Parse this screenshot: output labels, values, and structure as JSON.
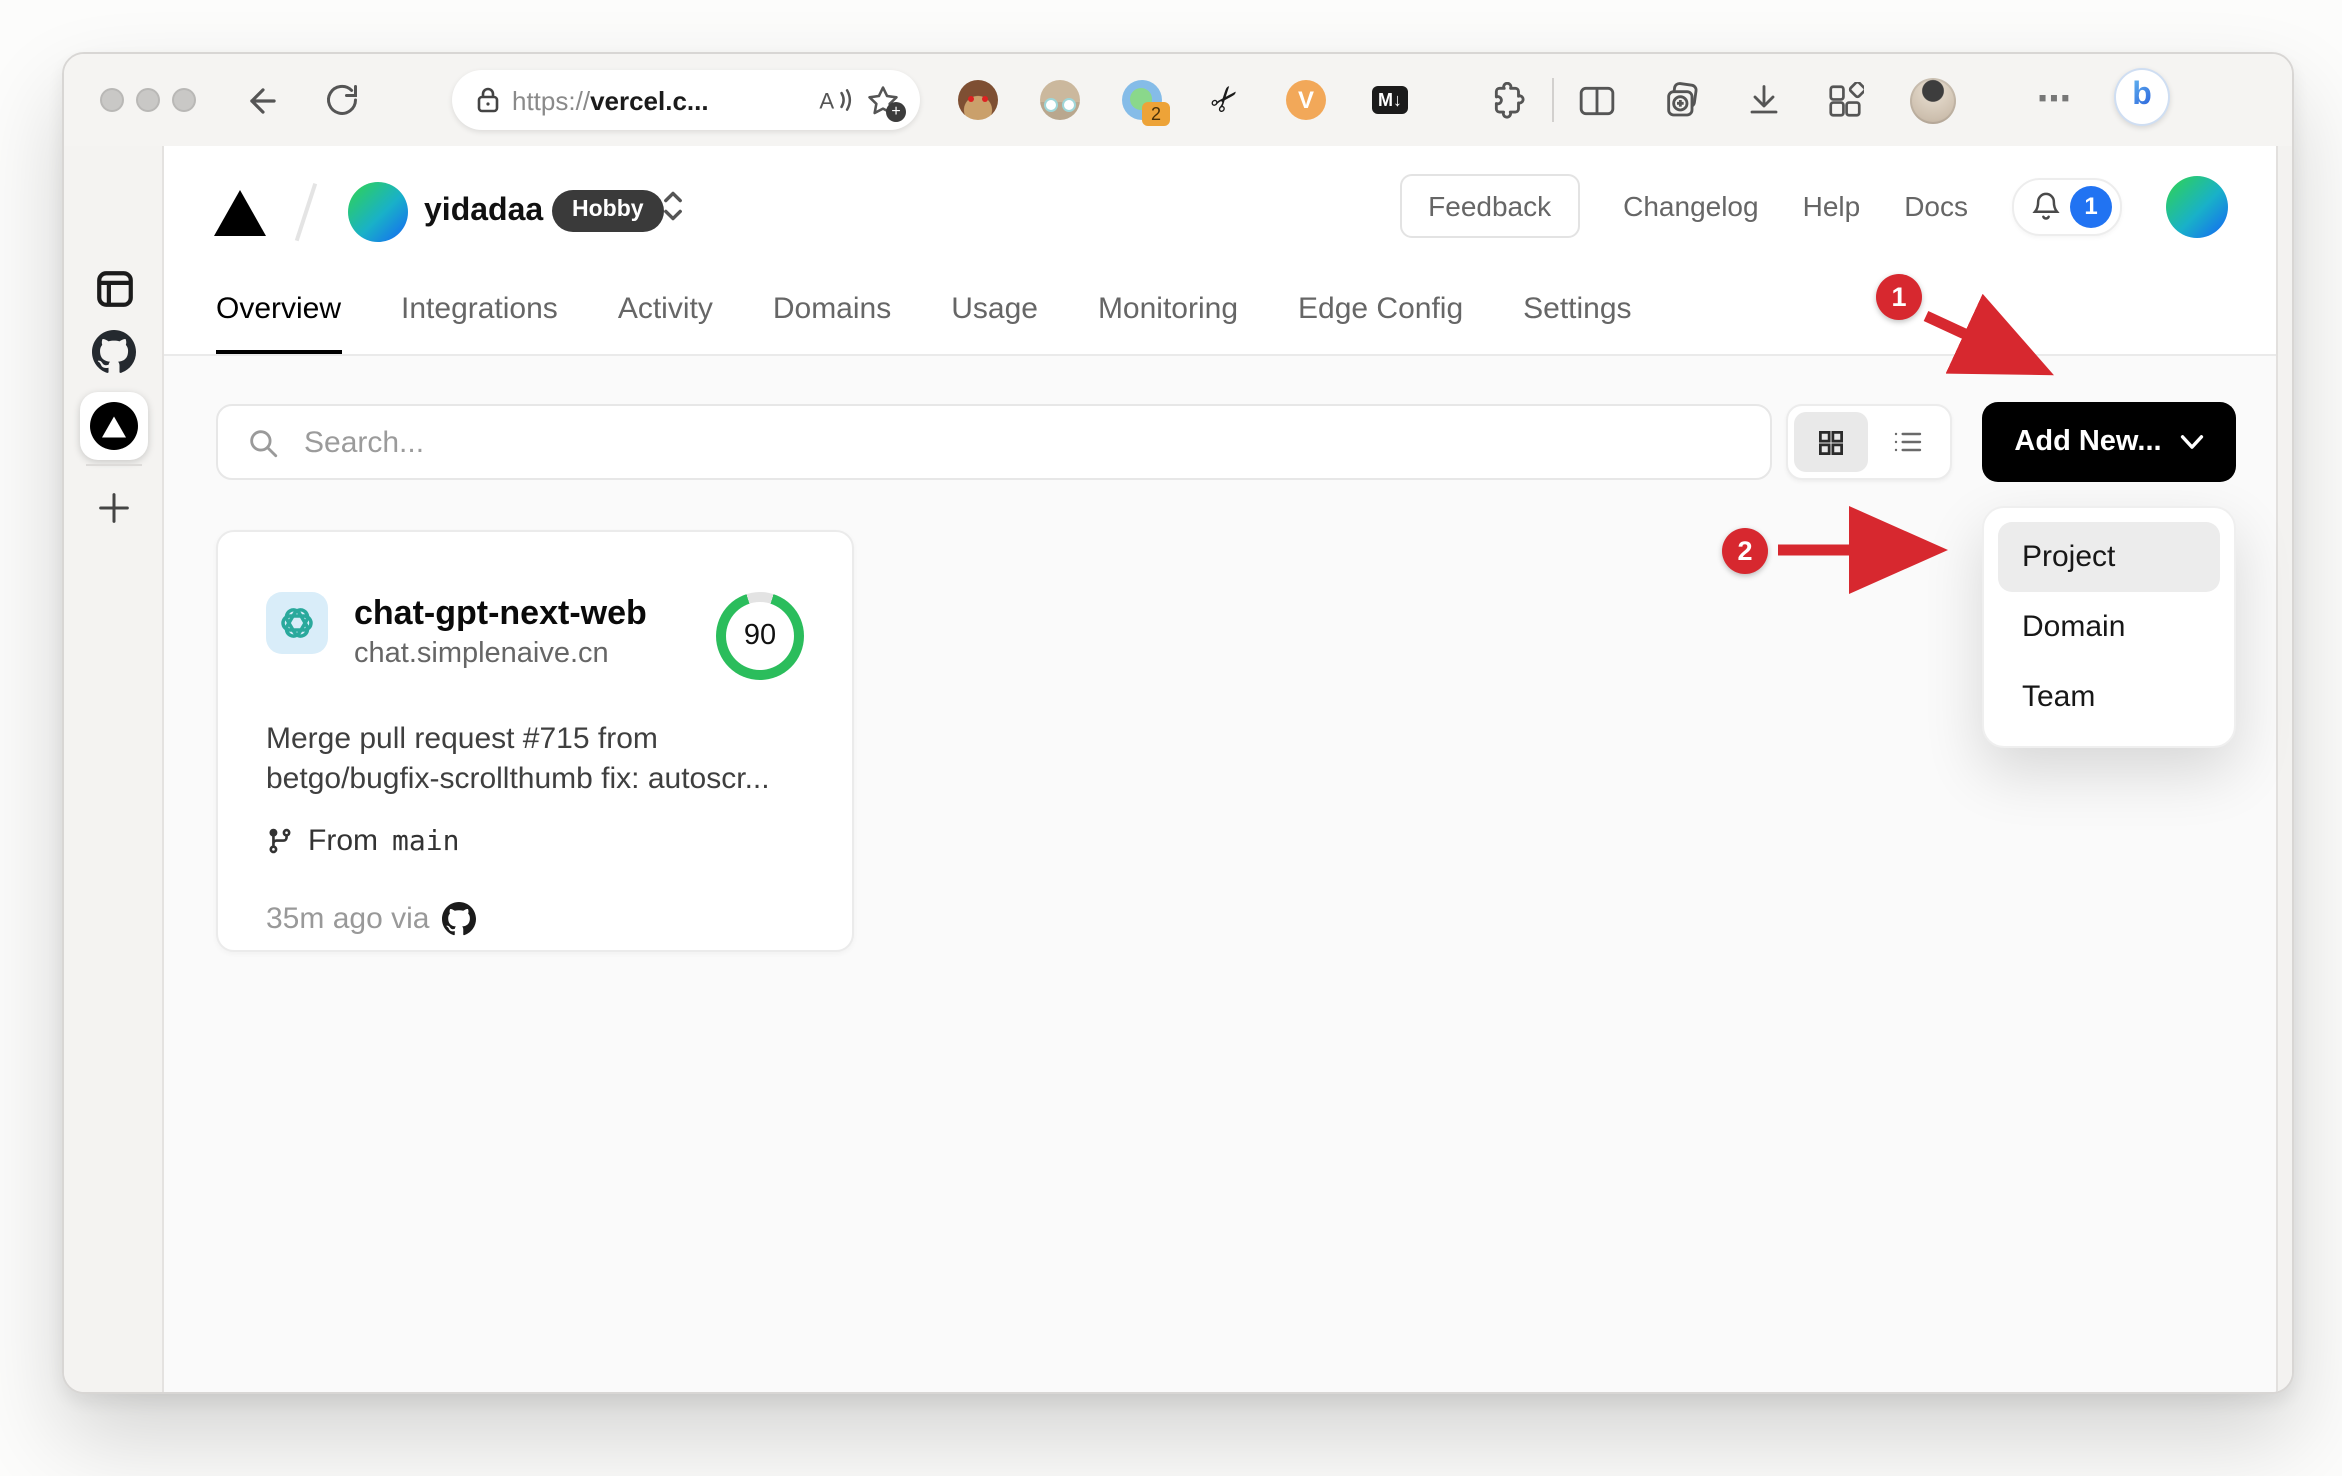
{
  "browser": {
    "url_scheme": "https://",
    "url_host": "vercel.c...",
    "extensions": {
      "badge_count": "2",
      "vimium_letter": "V",
      "markdown_label": "M↓",
      "scissors_glyph": "✂",
      "more_glyph": "⋯",
      "bing_letter": "b"
    }
  },
  "vercel": {
    "team": "yidadaa",
    "plan": "Hobby",
    "nav": {
      "feedback": "Feedback",
      "changelog": "Changelog",
      "help": "Help",
      "docs": "Docs"
    },
    "notification_count": "1",
    "tabs": [
      "Overview",
      "Integrations",
      "Activity",
      "Domains",
      "Usage",
      "Monitoring",
      "Edge Config",
      "Settings"
    ],
    "toolbar": {
      "search_placeholder": "Search...",
      "add_new_label": "Add New..."
    },
    "menu": [
      "Project",
      "Domain",
      "Team"
    ],
    "card": {
      "name": "chat-gpt-next-web",
      "domain": "chat.simplenaive.cn",
      "score": "90",
      "commit_line1": "Merge pull request #715 from",
      "commit_line2": "betgo/bugfix-scrollthumb fix: autoscr...",
      "branch_prefix": "From",
      "branch_name": "main",
      "deployed_meta": "35m ago via"
    }
  },
  "annotations": {
    "step1": "1",
    "step2": "2"
  },
  "colors": {
    "annotation_red": "#d7282f",
    "score_green": "#2bbd5c",
    "notification_blue": "#2173f2",
    "add_new_bg": "#000000",
    "plan_badge_bg": "#3a3a3a"
  }
}
